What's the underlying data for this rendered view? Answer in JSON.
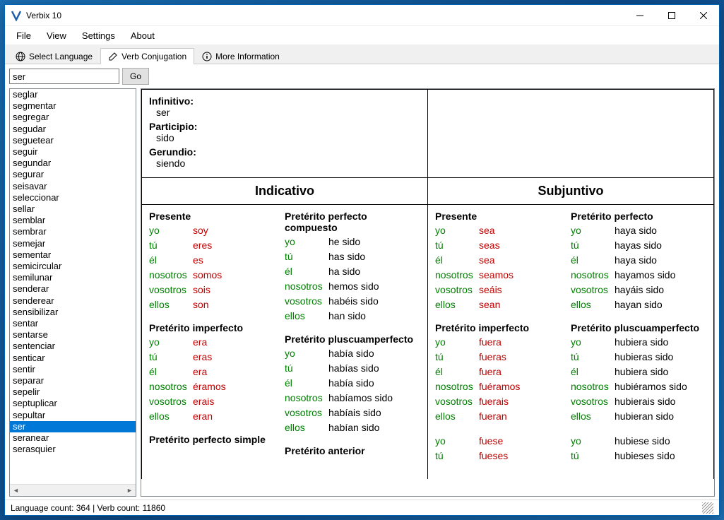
{
  "titlebar": {
    "title": "Verbix 10"
  },
  "menu": {
    "file": "File",
    "view": "View",
    "settings": "Settings",
    "about": "About"
  },
  "tabs": {
    "select_lang": "Select Language",
    "verb_conj": "Verb Conjugation",
    "more_info": "More Information"
  },
  "search": {
    "value": "ser",
    "go": "Go"
  },
  "verb_list": [
    "seglar",
    "segmentar",
    "segregar",
    "segudar",
    "seguetear",
    "seguir",
    "segundar",
    "segurar",
    "seisavar",
    "seleccionar",
    "sellar",
    "semblar",
    "sembrar",
    "semejar",
    "sementar",
    "semicircular",
    "semilunar",
    "senderar",
    "senderear",
    "sensibilizar",
    "sentar",
    "sentarse",
    "sentenciar",
    "senticar",
    "sentir",
    "separar",
    "sepelir",
    "septuplicar",
    "sepultar",
    "ser",
    "seranear",
    "serasquier"
  ],
  "selected_verb": "ser",
  "nominal": {
    "infinitivo_label": "Infinitivo:",
    "infinitivo": "ser",
    "participio_label": "Participio:",
    "participio": "sido",
    "gerundio_label": "Gerundio:",
    "gerundio": "siendo"
  },
  "moods": {
    "indicativo": "Indicativo",
    "subjuntivo": "Subjuntivo"
  },
  "pronouns": [
    "yo",
    "tú",
    "él",
    "nosotros",
    "vosotros",
    "ellos"
  ],
  "ind": {
    "presente": {
      "title": "Presente",
      "forms": [
        "soy",
        "eres",
        "es",
        "somos",
        "sois",
        "son"
      ],
      "irregular": true
    },
    "pret_perf_comp": {
      "title": "Pretérito perfecto compuesto",
      "forms": [
        "he sido",
        "has sido",
        "ha sido",
        "hemos sido",
        "habéis sido",
        "han sido"
      ],
      "irregular": false
    },
    "pret_imp": {
      "title": "Pretérito imperfecto",
      "forms": [
        "era",
        "eras",
        "era",
        "éramos",
        "erais",
        "eran"
      ],
      "irregular": true
    },
    "pret_plus": {
      "title": "Pretérito pluscuamperfecto",
      "forms": [
        "había sido",
        "habías sido",
        "había sido",
        "habíamos sido",
        "habíais sido",
        "habían sido"
      ],
      "irregular": false
    },
    "pret_simple": {
      "title": "Pretérito perfecto simple"
    },
    "pret_ant": {
      "title": "Pretérito anterior"
    }
  },
  "subj": {
    "presente": {
      "title": "Presente",
      "forms": [
        "sea",
        "seas",
        "sea",
        "seamos",
        "seáis",
        "sean"
      ],
      "irregular": true
    },
    "pret_perf": {
      "title": "Pretérito perfecto",
      "forms": [
        "haya sido",
        "hayas sido",
        "haya sido",
        "hayamos sido",
        "hayáis sido",
        "hayan sido"
      ],
      "irregular": false
    },
    "pret_imp": {
      "title": "Pretérito imperfecto",
      "forms": [
        "fuera",
        "fueras",
        "fuera",
        "fuéramos",
        "fuerais",
        "fueran"
      ],
      "irregular": true
    },
    "pret_plus": {
      "title": "Pretérito pluscuamperfecto",
      "forms": [
        "hubiera sido",
        "hubieras sido",
        "hubiera sido",
        "hubiéramos sido",
        "hubierais sido",
        "hubieran sido"
      ],
      "irregular": false
    },
    "pret_imp2": {
      "forms": [
        "fuese",
        "fueses"
      ],
      "irregular": true
    },
    "pret_plus2": {
      "forms": [
        "hubiese sido",
        "hubieses sido"
      ],
      "irregular": false
    }
  },
  "status": {
    "text": "Language count: 364  |  Verb count: 11860"
  }
}
